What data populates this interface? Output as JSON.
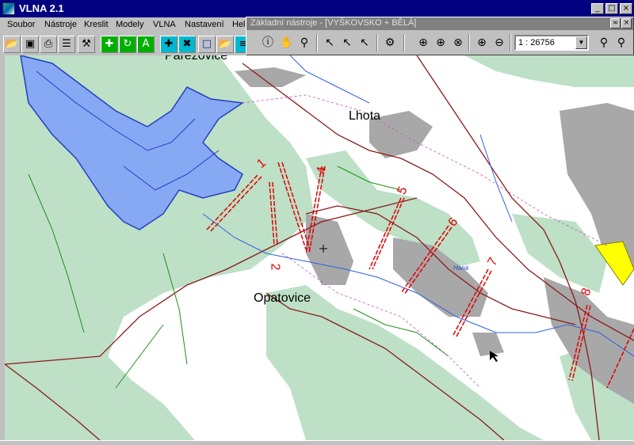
{
  "app": {
    "title": "VLNA 2.1"
  },
  "window_controls": {
    "minimize": "_",
    "maximize": "□",
    "close": "×"
  },
  "menu": [
    "Soubor",
    "Nástroje",
    "Kreslit",
    "Modely",
    "VLNA",
    "Nastavení",
    "Hel"
  ],
  "tools_window": {
    "title": "Základní nástroje - [VYŠKOVSKO + BĚLÁ]",
    "scale_value": "1 : 26756"
  },
  "toolbar_icons": [
    "open-folder-icon",
    "save-icon",
    "print-icon",
    "layers-icon",
    "tools-icon",
    "add-node-icon",
    "refresh-icon",
    "label-icon",
    "add-profile-icon",
    "delete-profile-icon",
    "new-document-icon",
    "open-file-icon",
    "table-icon"
  ],
  "map": {
    "places": [
      "Parezovice",
      "Lhota",
      "Opatovice"
    ],
    "sections": [
      "1",
      "2",
      "4",
      "5",
      "6",
      "7",
      "8"
    ],
    "river_label": "Haná",
    "colors": {
      "forest": "#bde0c6",
      "water": "#87a9f4",
      "urban": "#a8a8a8",
      "section": "#e00000",
      "road": "#8b1a1a",
      "highlight": "#ffff00"
    }
  }
}
